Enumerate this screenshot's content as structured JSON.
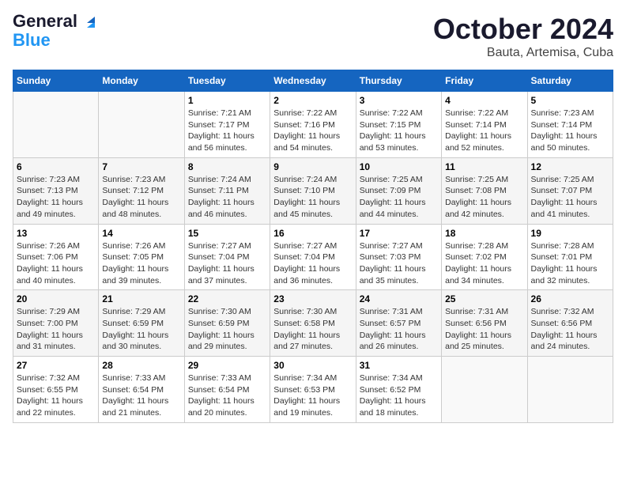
{
  "logo": {
    "line1": "General",
    "line2": "Blue"
  },
  "title": "October 2024",
  "subtitle": "Bauta, Artemisa, Cuba",
  "headers": [
    "Sunday",
    "Monday",
    "Tuesday",
    "Wednesday",
    "Thursday",
    "Friday",
    "Saturday"
  ],
  "weeks": [
    [
      {
        "day": "",
        "info": ""
      },
      {
        "day": "",
        "info": ""
      },
      {
        "day": "1",
        "info": "Sunrise: 7:21 AM\nSunset: 7:17 PM\nDaylight: 11 hours and 56 minutes."
      },
      {
        "day": "2",
        "info": "Sunrise: 7:22 AM\nSunset: 7:16 PM\nDaylight: 11 hours and 54 minutes."
      },
      {
        "day": "3",
        "info": "Sunrise: 7:22 AM\nSunset: 7:15 PM\nDaylight: 11 hours and 53 minutes."
      },
      {
        "day": "4",
        "info": "Sunrise: 7:22 AM\nSunset: 7:14 PM\nDaylight: 11 hours and 52 minutes."
      },
      {
        "day": "5",
        "info": "Sunrise: 7:23 AM\nSunset: 7:14 PM\nDaylight: 11 hours and 50 minutes."
      }
    ],
    [
      {
        "day": "6",
        "info": "Sunrise: 7:23 AM\nSunset: 7:13 PM\nDaylight: 11 hours and 49 minutes."
      },
      {
        "day": "7",
        "info": "Sunrise: 7:23 AM\nSunset: 7:12 PM\nDaylight: 11 hours and 48 minutes."
      },
      {
        "day": "8",
        "info": "Sunrise: 7:24 AM\nSunset: 7:11 PM\nDaylight: 11 hours and 46 minutes."
      },
      {
        "day": "9",
        "info": "Sunrise: 7:24 AM\nSunset: 7:10 PM\nDaylight: 11 hours and 45 minutes."
      },
      {
        "day": "10",
        "info": "Sunrise: 7:25 AM\nSunset: 7:09 PM\nDaylight: 11 hours and 44 minutes."
      },
      {
        "day": "11",
        "info": "Sunrise: 7:25 AM\nSunset: 7:08 PM\nDaylight: 11 hours and 42 minutes."
      },
      {
        "day": "12",
        "info": "Sunrise: 7:25 AM\nSunset: 7:07 PM\nDaylight: 11 hours and 41 minutes."
      }
    ],
    [
      {
        "day": "13",
        "info": "Sunrise: 7:26 AM\nSunset: 7:06 PM\nDaylight: 11 hours and 40 minutes."
      },
      {
        "day": "14",
        "info": "Sunrise: 7:26 AM\nSunset: 7:05 PM\nDaylight: 11 hours and 39 minutes."
      },
      {
        "day": "15",
        "info": "Sunrise: 7:27 AM\nSunset: 7:04 PM\nDaylight: 11 hours and 37 minutes."
      },
      {
        "day": "16",
        "info": "Sunrise: 7:27 AM\nSunset: 7:04 PM\nDaylight: 11 hours and 36 minutes."
      },
      {
        "day": "17",
        "info": "Sunrise: 7:27 AM\nSunset: 7:03 PM\nDaylight: 11 hours and 35 minutes."
      },
      {
        "day": "18",
        "info": "Sunrise: 7:28 AM\nSunset: 7:02 PM\nDaylight: 11 hours and 34 minutes."
      },
      {
        "day": "19",
        "info": "Sunrise: 7:28 AM\nSunset: 7:01 PM\nDaylight: 11 hours and 32 minutes."
      }
    ],
    [
      {
        "day": "20",
        "info": "Sunrise: 7:29 AM\nSunset: 7:00 PM\nDaylight: 11 hours and 31 minutes."
      },
      {
        "day": "21",
        "info": "Sunrise: 7:29 AM\nSunset: 6:59 PM\nDaylight: 11 hours and 30 minutes."
      },
      {
        "day": "22",
        "info": "Sunrise: 7:30 AM\nSunset: 6:59 PM\nDaylight: 11 hours and 29 minutes."
      },
      {
        "day": "23",
        "info": "Sunrise: 7:30 AM\nSunset: 6:58 PM\nDaylight: 11 hours and 27 minutes."
      },
      {
        "day": "24",
        "info": "Sunrise: 7:31 AM\nSunset: 6:57 PM\nDaylight: 11 hours and 26 minutes."
      },
      {
        "day": "25",
        "info": "Sunrise: 7:31 AM\nSunset: 6:56 PM\nDaylight: 11 hours and 25 minutes."
      },
      {
        "day": "26",
        "info": "Sunrise: 7:32 AM\nSunset: 6:56 PM\nDaylight: 11 hours and 24 minutes."
      }
    ],
    [
      {
        "day": "27",
        "info": "Sunrise: 7:32 AM\nSunset: 6:55 PM\nDaylight: 11 hours and 22 minutes."
      },
      {
        "day": "28",
        "info": "Sunrise: 7:33 AM\nSunset: 6:54 PM\nDaylight: 11 hours and 21 minutes."
      },
      {
        "day": "29",
        "info": "Sunrise: 7:33 AM\nSunset: 6:54 PM\nDaylight: 11 hours and 20 minutes."
      },
      {
        "day": "30",
        "info": "Sunrise: 7:34 AM\nSunset: 6:53 PM\nDaylight: 11 hours and 19 minutes."
      },
      {
        "day": "31",
        "info": "Sunrise: 7:34 AM\nSunset: 6:52 PM\nDaylight: 11 hours and 18 minutes."
      },
      {
        "day": "",
        "info": ""
      },
      {
        "day": "",
        "info": ""
      }
    ]
  ]
}
